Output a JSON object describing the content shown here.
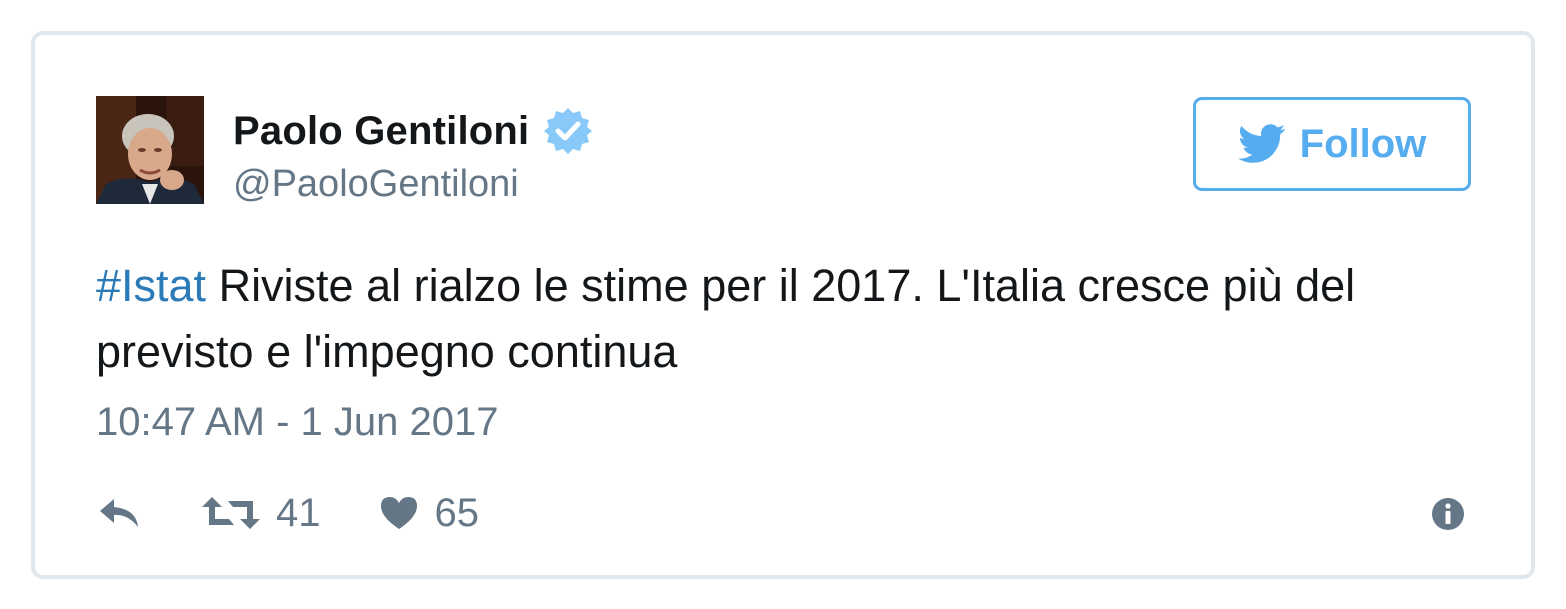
{
  "user": {
    "display_name": "Paolo Gentiloni",
    "handle": "@PaoloGentiloni",
    "verified_icon": "verified-badge-icon",
    "avatar": "profile-photo"
  },
  "follow_button": {
    "label": "Follow",
    "icon": "twitter-bird-icon"
  },
  "tweet": {
    "hashtag": "#Istat",
    "text": " Riviste al rialzo le stime per il 2017. L'Italia cresce più del previsto e l'impegno continua",
    "timestamp": "10:47 AM - 1 Jun 2017"
  },
  "actions": {
    "reply_icon": "reply-icon",
    "retweet_icon": "retweet-icon",
    "retweet_count": "41",
    "like_icon": "heart-icon",
    "like_count": "65",
    "info_icon": "info-icon"
  },
  "colors": {
    "accent": "#55acee",
    "hashtag": "#2b7bb9",
    "text": "#14171a",
    "secondary_text": "#657786",
    "border": "#e1e8ed"
  }
}
